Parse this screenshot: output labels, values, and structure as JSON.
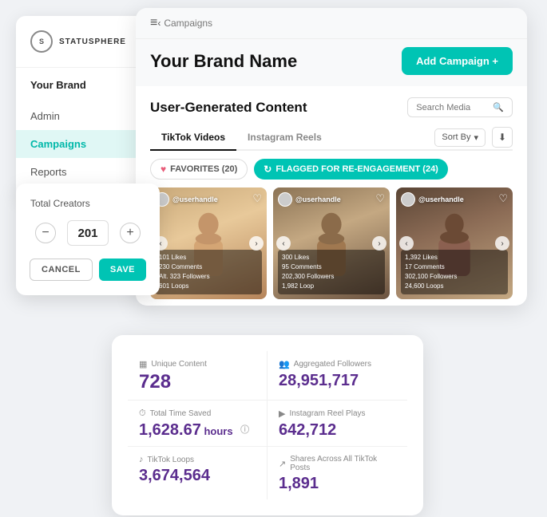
{
  "sidebar": {
    "logo_text": "STATUSPHERE",
    "brand_label": "Your Brand",
    "nav_items": [
      {
        "label": "Admin",
        "active": false
      },
      {
        "label": "Campaigns",
        "active": true
      },
      {
        "label": "Reports",
        "active": false
      }
    ]
  },
  "creators_popup": {
    "title": "Total Creators",
    "value": "201",
    "btn_cancel": "CANCEL",
    "btn_save": "SAVE"
  },
  "main": {
    "breadcrumb_back": "‹",
    "breadcrumb_text": "Campaigns",
    "brand_title": "Your Brand Name",
    "btn_add_campaign": "Add Campaign +",
    "hamburger": "≡",
    "ugc": {
      "title": "User-Generated Content",
      "search_placeholder": "Search Media",
      "tabs": [
        {
          "label": "TikTok Videos",
          "active": true
        },
        {
          "label": "Instagram Reels",
          "active": false
        }
      ],
      "sort_label": "Sort By",
      "pill_favorites": "FAVORITES (20)",
      "pill_flagged": "FLAGGED FOR RE-ENGAGEMENT (24)",
      "videos": [
        {
          "handle": "@userhandle",
          "stats": "101 Likes\n230 Comments\n Alt. 323 Followers\n601 Loops"
        },
        {
          "handle": "@userhandle",
          "stats": "300 Likes\n95 Comments\n202,300 Followers\n1,982 Loop"
        },
        {
          "handle": "@userhandle",
          "stats": "1,392 Likes\n17 Comments\n302,100 Followers\n24,600 Loops"
        }
      ]
    }
  },
  "stats": {
    "items": [
      {
        "label": "Unique Content",
        "label_icon": "grid",
        "value": "728"
      },
      {
        "label": "Aggregated Followers",
        "label_icon": "people",
        "value": "28,951,717"
      },
      {
        "label": "Total Time Saved",
        "label_icon": "clock",
        "value": "1,628.67",
        "suffix": " hours"
      },
      {
        "label": "Instagram Reel Plays",
        "label_icon": "play",
        "value": "642,712"
      },
      {
        "label": "TikTok Loops",
        "label_icon": "tiktok",
        "value": "3,674,564"
      },
      {
        "label": "Shares Across All TikTok Posts",
        "label_icon": "share",
        "value": "1,891"
      }
    ]
  }
}
